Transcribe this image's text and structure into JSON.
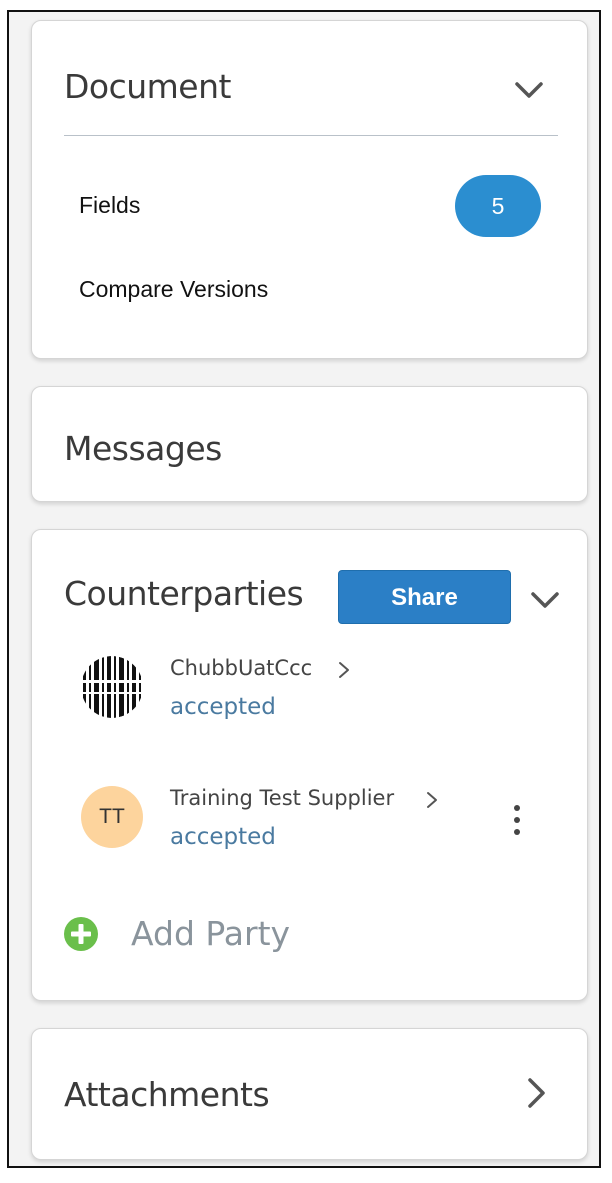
{
  "document": {
    "title": "Document",
    "fields_label": "Fields",
    "fields_count": "5",
    "compare_label": "Compare Versions"
  },
  "messages": {
    "title": "Messages"
  },
  "counterparties": {
    "title": "Counterparties",
    "share_label": "Share",
    "parties": [
      {
        "name": "ChubbUatCcc",
        "status": "accepted",
        "avatar": "barcode-logo"
      },
      {
        "name": "Training Test Supplier",
        "status": "accepted",
        "initials": "TT"
      }
    ],
    "add_party_label": "Add Party"
  },
  "attachments": {
    "title": "Attachments"
  },
  "colors": {
    "accent": "#2b8ed0",
    "share_button": "#2b7fc6",
    "add_icon": "#6abf4b",
    "status_text": "#4a7aa0",
    "avatar_tt": "#fdd49d"
  },
  "icons": [
    "chevron-down-icon",
    "chevron-right-icon",
    "plus-circle-icon",
    "kebab-menu-icon"
  ]
}
